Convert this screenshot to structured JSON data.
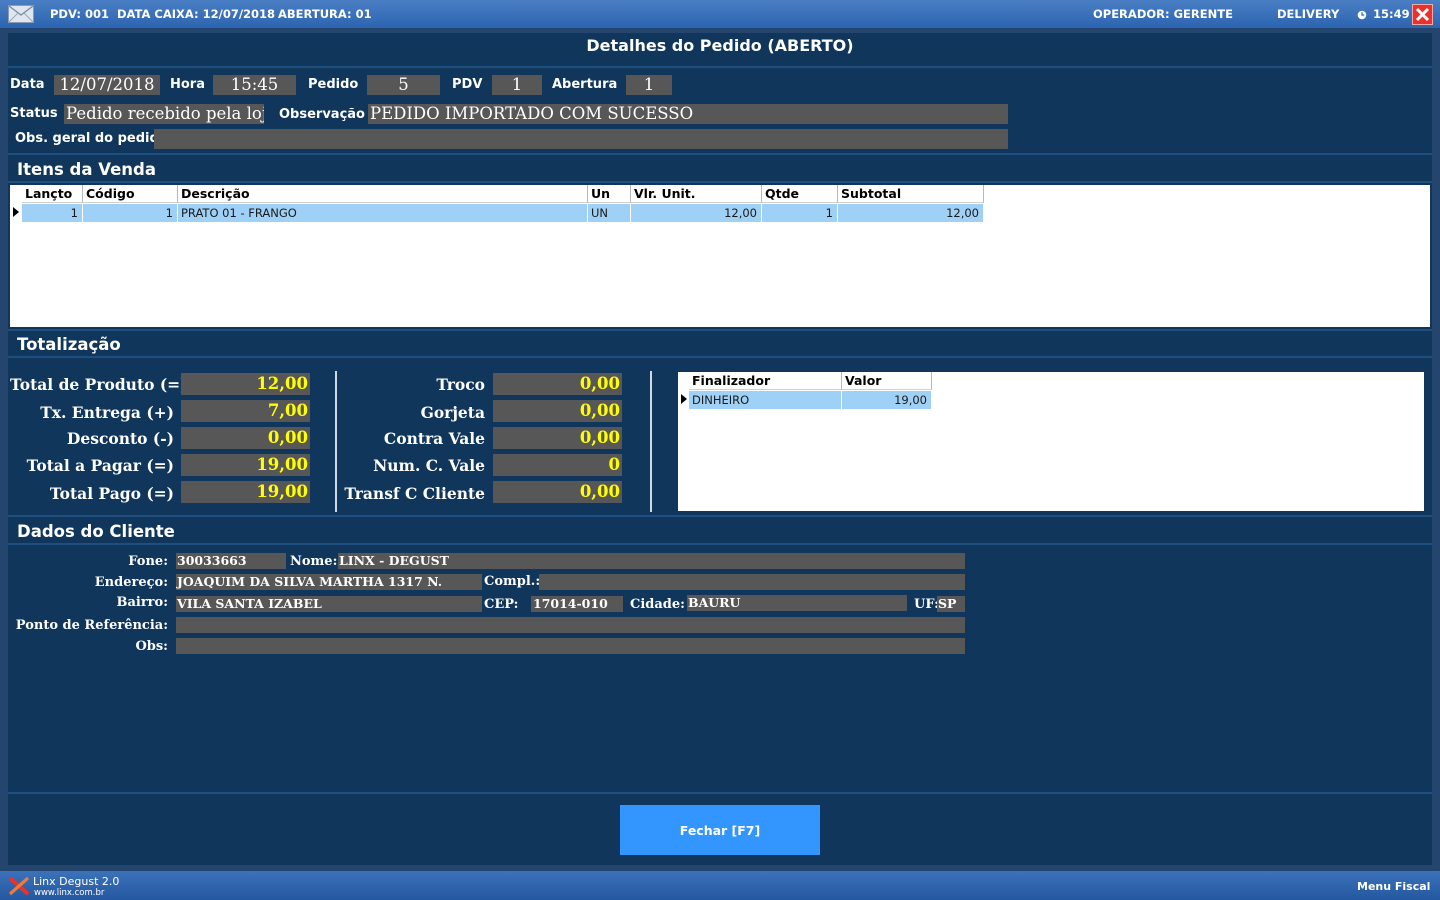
{
  "topbar": {
    "pdv": "PDV: 001",
    "data_caixa": "DATA CAIXA: 12/07/2018",
    "abertura": "ABERTURA: 01",
    "operador": "OPERADOR:  GERENTE",
    "delivery": "DELIVERY",
    "time": "15:49"
  },
  "title": "Detalhes do Pedido (ABERTO)",
  "header": {
    "data_label": "Data",
    "data_value": "12/07/2018",
    "hora_label": "Hora",
    "hora_value": "15:45",
    "pedido_label": "Pedido",
    "pedido_value": "5",
    "pdv_label": "PDV",
    "pdv_value": "1",
    "abertura_label": "Abertura",
    "abertura_value": "1",
    "status_label": "Status",
    "status_value": "Pedido recebido pela loja",
    "obs_label": "Observação",
    "obs_value": "PEDIDO IMPORTADO COM SUCESSO",
    "obs_geral_label": "Obs. geral do pedido",
    "obs_geral_value": ""
  },
  "itens": {
    "title": "Itens da Venda",
    "columns": [
      "Lançto",
      "Código",
      "Descrição",
      "Un",
      "Vlr. Unit.",
      "Qtde",
      "Subtotal"
    ],
    "rows": [
      [
        "1",
        "1",
        "PRATO 01 - FRANGO",
        "UN",
        "12,00",
        "1",
        "12,00"
      ]
    ]
  },
  "totalizacao": {
    "title": "Totalização",
    "left": [
      {
        "label": "Total de Produto (=)",
        "value": "12,00"
      },
      {
        "label": "Tx. Entrega (+)",
        "value": "7,00"
      },
      {
        "label": "Desconto (-)",
        "value": "0,00"
      },
      {
        "label": "Total a Pagar (=)",
        "value": "19,00"
      },
      {
        "label": "Total Pago (=)",
        "value": "19,00"
      }
    ],
    "right": [
      {
        "label": "Troco",
        "value": "0,00"
      },
      {
        "label": "Gorjeta",
        "value": "0,00"
      },
      {
        "label": "Contra Vale",
        "value": "0,00"
      },
      {
        "label": "Num. C. Vale",
        "value": "0"
      },
      {
        "label": "Transf C Cliente",
        "value": "0,00"
      }
    ],
    "payment_columns": [
      "Finalizador",
      "Valor"
    ],
    "payments": [
      [
        "DINHEIRO",
        "19,00"
      ]
    ]
  },
  "cliente": {
    "title": "Dados do Cliente",
    "fone_label": "Fone:",
    "fone": "30033663",
    "nome_label": "Nome:",
    "nome": "LINX - DEGUST",
    "endereco_label": "Endereço:",
    "endereco": "JOAQUIM DA SILVA MARTHA 1317 N.",
    "compl_label": "Compl.:",
    "compl": "",
    "bairro_label": "Bairro:",
    "bairro": "VILA SANTA IZABEL",
    "cep_label": "CEP:",
    "cep": "17014-010",
    "cidade_label": "Cidade:",
    "cidade": "BAURU",
    "uf_label": "UF:",
    "uf": "SP",
    "ponto_label": "Ponto de Referência:",
    "ponto": "",
    "obs_label": "Obs:",
    "obs": ""
  },
  "fechar_label": "Fechar [F7]",
  "footer": {
    "brand": "Linx Degust 2.0",
    "url": "www.linx.com.br",
    "menu_fiscal": "Menu Fiscal"
  },
  "colors": {
    "background": "#24456d",
    "panel": "#10365b",
    "field": "#575757",
    "value_yellow": "#ffff00",
    "selected_row": "#9fd0f6",
    "button": "#3396ff",
    "close": "#e8322d"
  }
}
